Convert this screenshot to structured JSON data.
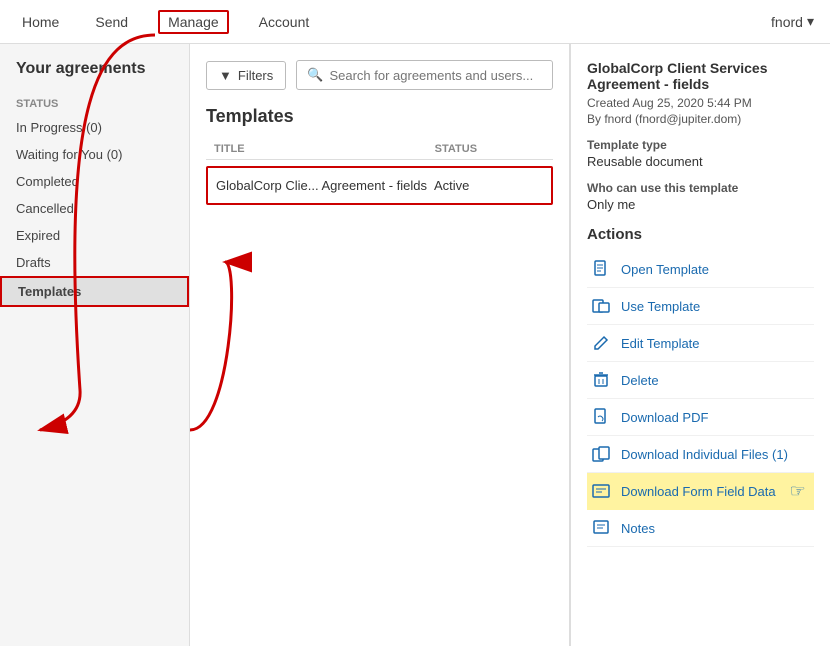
{
  "nav": {
    "items": [
      "Home",
      "Send",
      "Manage",
      "Account"
    ],
    "active": "Manage",
    "user": "fnord"
  },
  "sidebar": {
    "title": "Your agreements",
    "status_label": "STATUS",
    "items": [
      {
        "label": "In Progress (0)"
      },
      {
        "label": "Waiting for You (0)"
      },
      {
        "label": "Completed"
      },
      {
        "label": "Cancelled"
      },
      {
        "label": "Expired"
      },
      {
        "label": "Drafts"
      },
      {
        "label": "Templates",
        "selected": true
      }
    ]
  },
  "toolbar": {
    "filter_label": "Filters",
    "search_placeholder": "Search for agreements and users..."
  },
  "main": {
    "section_title": "Templates",
    "columns": [
      "TITLE",
      "STATUS"
    ],
    "rows": [
      {
        "title": "GlobalCorp Clie... Agreement - fields",
        "status": "Active"
      }
    ]
  },
  "right_panel": {
    "title": "GlobalCorp Client Services Agreement - fields",
    "created": "Created Aug 25, 2020 5:44 PM",
    "by": "By fnord (fnord@jupiter.dom)",
    "template_type_label": "Template type",
    "template_type_value": "Reusable document",
    "who_label": "Who can use this template",
    "who_value": "Only me",
    "actions_label": "Actions",
    "actions": [
      {
        "label": "Open Template",
        "icon": "doc-icon"
      },
      {
        "label": "Use Template",
        "icon": "use-icon"
      },
      {
        "label": "Edit Template",
        "icon": "edit-icon"
      },
      {
        "label": "Delete",
        "icon": "trash-icon"
      },
      {
        "label": "Download PDF",
        "icon": "pdf-icon"
      },
      {
        "label": "Download Individual Files (1)",
        "icon": "files-icon"
      },
      {
        "label": "Download Form Field Data",
        "icon": "form-icon",
        "highlighted": true
      },
      {
        "label": "Notes",
        "icon": "notes-icon"
      }
    ]
  }
}
